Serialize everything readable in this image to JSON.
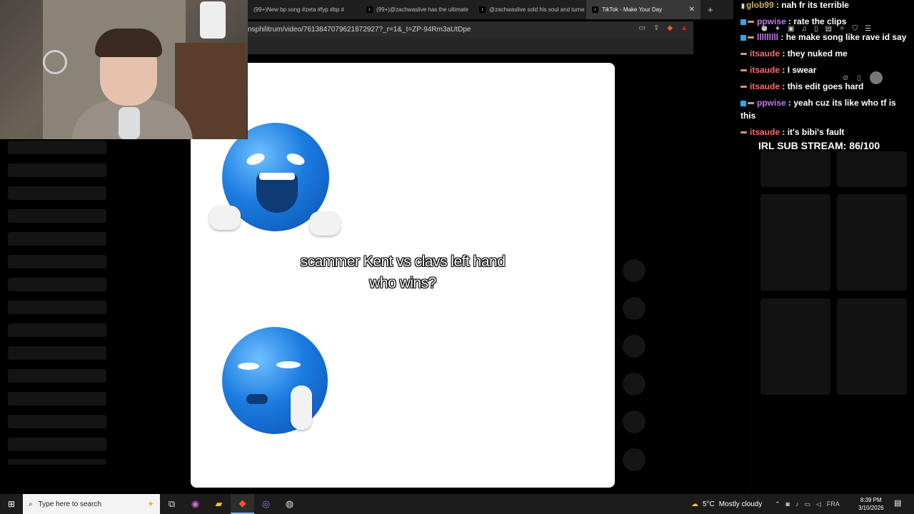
{
  "browser": {
    "tabs": [
      {
        "label": "(99+)New bp song #zeta #fyp #bp #"
      },
      {
        "label": "(99+)@zachwaslive has the ultimate"
      },
      {
        "label": "@zachwaslive sold his soul and turne"
      },
      {
        "label": "TikTok - Make Your Day"
      }
    ],
    "new_tab_label": "+",
    "url": "nsphilitrum/video/7613847079621872927?_r=1&_t=ZP-94Rm3aUtDpe",
    "window_controls": [
      "–",
      "◻",
      "✕"
    ]
  },
  "video": {
    "caption_line1": "scammer Kent vs clavs left hand",
    "caption_line2": "who wins?"
  },
  "chat": {
    "messages": [
      {
        "user": "glob99",
        "text": "nah fr its terrible",
        "color": "#c8b060"
      },
      {
        "user": "ppwise",
        "text": "rate the clips",
        "color": "#c278f0"
      },
      {
        "user": "lllllllll",
        "text": "he make song like rave id say",
        "color": "#c278f0"
      },
      {
        "user": "itsaude",
        "text": "they nuked me",
        "color": "#ff6a6a"
      },
      {
        "user": "itsaude",
        "text": "I swear",
        "color": "#ff6a6a"
      },
      {
        "user": "itsaude",
        "text": "this edit goes hard",
        "color": "#ff6a6a"
      },
      {
        "user": "ppwise",
        "text": "yeah cuz its like who tf is this",
        "color": "#c278f0"
      },
      {
        "user": "itsaude",
        "text": "it's bibi's fault",
        "color": "#ff6a6a"
      }
    ],
    "separator": " : ",
    "sub_goal": "IRL SUB STREAM: 86/100"
  },
  "taskbar": {
    "search_placeholder": "Type here to search",
    "weather_temp": "5°C",
    "weather_text": "Mostly cloudy",
    "language": "FRA",
    "time": "8:39 PM",
    "date": "3/10/2026"
  },
  "colors": {
    "accent_brave": "#fb542b",
    "tiktok_bg": "#000000"
  }
}
